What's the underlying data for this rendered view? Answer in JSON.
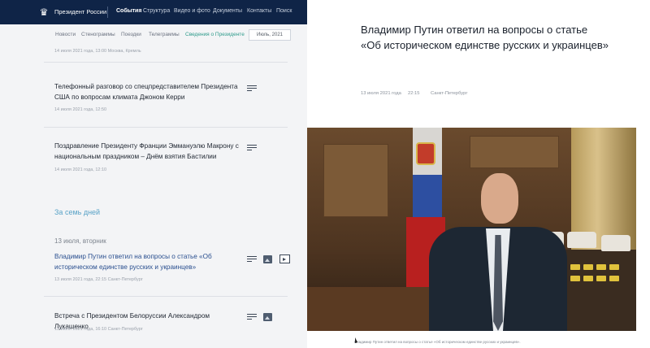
{
  "nav": {
    "brand": "Президент России",
    "items": [
      "События",
      "Структура",
      "Видео и фото",
      "Документы",
      "Контакты",
      "Поиск"
    ],
    "active": "События"
  },
  "subtabs": {
    "items": [
      "Новости",
      "Стенограммы",
      "Поездки",
      "Телеграммы",
      "Сведения о Президенте"
    ],
    "active_index": 4,
    "month": "Июль, 2021"
  },
  "feed": {
    "top_meta": "14 июля 2021 года, 13:00    Москва, Кремль",
    "items": [
      {
        "title": "Телефонный разговор со спецпредставителем Президента США по вопросам климата Джоном Керри",
        "meta": "14 июля 2021 года, 12:50"
      },
      {
        "title": "Поздравление Президенту Франции Эммануэлю Макрону с национальным праздником – Днём взятия Бастилии",
        "meta": "14 июля 2021 года, 12:10"
      }
    ],
    "section_label": "За семь дней",
    "day_label": "13 июля, вторник",
    "items2": [
      {
        "title": "Владимир Путин ответил на вопросы о статье «Об историческом единстве русских и украинцев»",
        "meta": "13 июля 2021 года, 22:15    Санкт-Петербург"
      },
      {
        "title": "Встреча с Президентом Белоруссии Александром Лукашенко",
        "meta": "13 июля 2021 года, 16:10    Санкт-Петербург"
      }
    ]
  },
  "article": {
    "title_line1": "Владимир Путин ответил на вопросы о статье",
    "title_line2": "«Об историческом единстве русских и украинцев»",
    "date": "13 июля 2021 года",
    "time": "22:15",
    "place": "Санкт-Петербург",
    "caption": "Владимир Путин ответил на вопросы о статье «Об историческом единстве русских и украинцев»."
  },
  "icons": {
    "logo": "coat-of-arms-icon",
    "text": "text-icon",
    "photo": "photo-icon",
    "video": "video-icon"
  }
}
